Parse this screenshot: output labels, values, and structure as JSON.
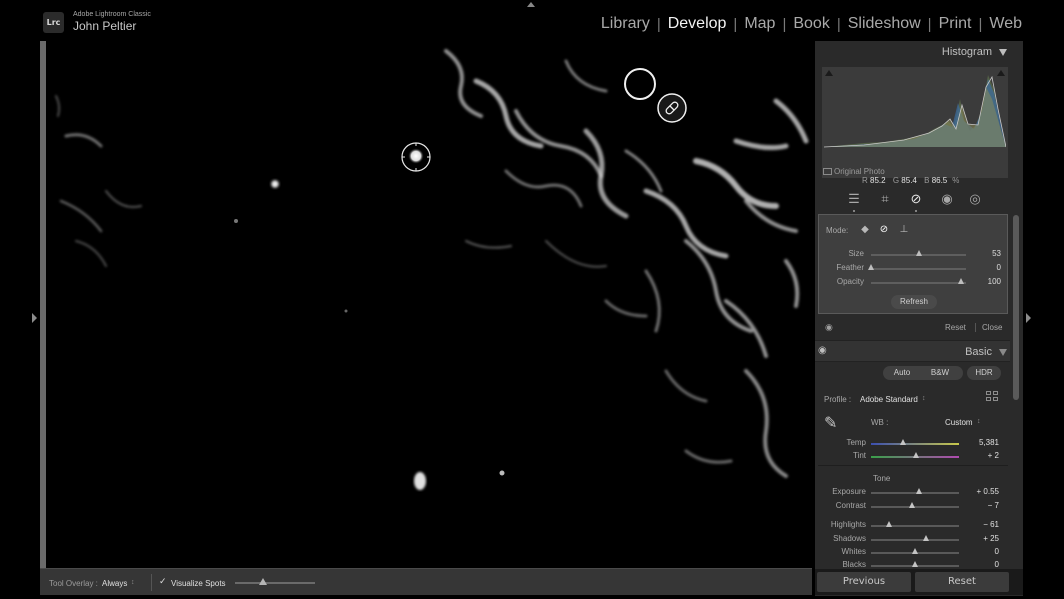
{
  "app": {
    "logo_text": "Lrc",
    "app_name": "Adobe Lightroom Classic",
    "user_name": "John Peltier"
  },
  "modules": [
    {
      "label": "Library",
      "active": false
    },
    {
      "label": "Develop",
      "active": true
    },
    {
      "label": "Map",
      "active": false
    },
    {
      "label": "Book",
      "active": false
    },
    {
      "label": "Slideshow",
      "active": false
    },
    {
      "label": "Print",
      "active": false
    },
    {
      "label": "Web",
      "active": false
    }
  ],
  "module_separator": "|",
  "histogram": {
    "title": "Histogram",
    "r_label": "R",
    "r_value": "85.2",
    "g_label": "G",
    "g_value": "85.4",
    "b_label": "B",
    "b_value": "86.5",
    "unit": "%",
    "original_photo_label": "Original Photo"
  },
  "tool_strip": {
    "icons": [
      "sliders-icon",
      "crop-icon",
      "healing-icon",
      "redeye-icon",
      "masking-icon"
    ],
    "active": "healing-icon"
  },
  "spot_removal": {
    "mode_label": "Mode:",
    "modes": [
      "content-aware-icon",
      "heal-icon",
      "clone-icon"
    ],
    "active_mode": "heal-icon",
    "sliders": [
      {
        "label": "Size",
        "value": "53",
        "position": 0.5
      },
      {
        "label": "Feather",
        "value": "0",
        "position": 0.0
      },
      {
        "label": "Opacity",
        "value": "100",
        "position": 0.95
      }
    ],
    "refresh_label": "Refresh",
    "reset_label": "Reset",
    "close_label": "Close"
  },
  "basic": {
    "title": "Basic",
    "auto_label": "Auto",
    "bw_label": "B&W",
    "hdr_label": "HDR",
    "profile_label": "Profile :",
    "profile_value": "Adobe Standard",
    "profile_arrows": "↕",
    "wb_label": "WB :",
    "wb_value": "Custom",
    "wb_arrows": "↕",
    "tone_label": "Tone",
    "wb_sliders": [
      {
        "label": "Temp",
        "value": "5,381",
        "position": 0.36
      },
      {
        "label": "Tint",
        "value": "+ 2",
        "position": 0.51
      }
    ],
    "tone_sliders": [
      {
        "label": "Exposure",
        "value": "+ 0.55",
        "position": 0.55
      },
      {
        "label": "Contrast",
        "value": "− 7",
        "position": 0.47
      },
      {
        "label": "Highlights",
        "value": "− 61",
        "position": 0.2
      },
      {
        "label": "Shadows",
        "value": "+ 25",
        "position": 0.62
      },
      {
        "label": "Whites",
        "value": "0",
        "position": 0.5
      },
      {
        "label": "Blacks",
        "value": "0",
        "position": 0.5
      }
    ]
  },
  "panel_buttons": {
    "previous": "Previous",
    "reset": "Reset"
  },
  "toolbar": {
    "tool_overlay_label": "Tool Overlay :",
    "tool_overlay_value": "Always",
    "tool_overlay_arrows": "↕",
    "visualize_spots_label": "Visualize Spots",
    "visualize_spots_checked": true,
    "threshold_position": 0.35
  },
  "colors": {
    "background": "#000000",
    "panel": "#2a2a2a",
    "active_module": "#f2f2f2",
    "inactive_module": "#a9a9a9"
  }
}
